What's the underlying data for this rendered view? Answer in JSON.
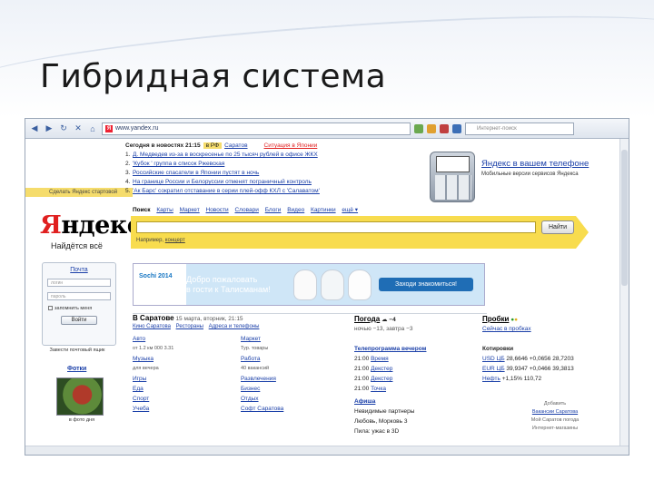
{
  "slide": {
    "title": "Гибридная система"
  },
  "browser": {
    "address": "www.yandex.ru",
    "search_placeholder": "Интернет-поиск",
    "nav_back": "◀",
    "nav_forward": "▶",
    "nav_refresh": "↻",
    "nav_stop": "✕",
    "nav_home": "⌂"
  },
  "news": {
    "header": "Сегодня в новостях 21:15",
    "tab_rf": "в РФ",
    "tab_saratov": "Саратов",
    "hot": "Ситуация в Японии",
    "items": [
      {
        "num": "1.",
        "text": "Д. Медведев из-за в воскресенье по 25 тысяч рублей в офисе ЖКХ"
      },
      {
        "num": "2.",
        "text": "'Кубок ' группа в список Ржевская"
      },
      {
        "num": "3.",
        "text": "Российские спасатели в Японии пустят в ночь"
      },
      {
        "num": "4.",
        "text": "На границе России и Белоруссии отменят пограничный контроль"
      },
      {
        "num": "5.",
        "text": "'Ак Барс' сократил отставание в серии плей-офф КХЛ с 'Салаватом'"
      }
    ]
  },
  "mobile": {
    "title": "Яндекс в вашем телефоне",
    "desc": "Мобильные версии сервисов Яндекса"
  },
  "left": {
    "logo_first": "Я",
    "logo_rest": "ндекс",
    "slogan": "Найдётся всё",
    "make_start": "Сделать Яндекс стартовой",
    "login_title": "Почта",
    "login_field": "логин",
    "password_field": "пароль",
    "remember": "запомнить меня",
    "login_button": "Войти",
    "make_home": "Завести почтовый ящик",
    "photos_title": "Фотки",
    "photo_caption": "в фото дня"
  },
  "services": {
    "items": [
      "Поиск",
      "Карты",
      "Маркет",
      "Новости",
      "Словари",
      "Блоги",
      "Видео",
      "Картинки",
      "ещё ▾"
    ]
  },
  "search": {
    "button": "Найти",
    "example_prefix": "Например,",
    "example": "концерт"
  },
  "banner": {
    "logo": "Sochi 2014",
    "text_line1": "Добро пожаловать",
    "text_line2": "в гости к Талисманам!",
    "button": "Заходи знакомиться!"
  },
  "city": {
    "title": "В Саратове",
    "date": "15 марта, вторник, 21:15",
    "subs": [
      "Кино Саратова",
      "Рестораны",
      "Адреса и телефоны"
    ],
    "left_items": [
      {
        "label": "Авто",
        "sub": "от 1.2 км 000 3.31"
      },
      {
        "label": "Музыка",
        "sub": "для вечера"
      },
      {
        "label": "Игры",
        "sub": ""
      },
      {
        "label": "Еда",
        "sub": ""
      },
      {
        "label": "Спорт",
        "sub": ""
      },
      {
        "label": "Учеба",
        "sub": ""
      }
    ],
    "right_items": [
      {
        "label": "Маркет",
        "sub": "Тур. товары"
      },
      {
        "label": "Работа",
        "sub": "40 вакансий"
      },
      {
        "label": "Развлечения",
        "sub": ""
      },
      {
        "label": "Бизнес",
        "sub": ""
      },
      {
        "label": "Отдых",
        "sub": ""
      },
      {
        "label": "Софт Саратова",
        "sub": ""
      }
    ]
  },
  "weather": {
    "title": "Погода",
    "temp": "−4",
    "detail": "ночью −13, завтра −3"
  },
  "tv": {
    "title": "Телепрограмма вечером",
    "rows": [
      {
        "time": "21:00",
        "show": "Время"
      },
      {
        "time": "21:00",
        "show": "Декстер"
      },
      {
        "time": "21:00",
        "show": "Декстер"
      },
      {
        "time": "21:00",
        "show": "Точка"
      }
    ]
  },
  "afisha": {
    "title": "Афиша",
    "rows": [
      "Невидимые партнеры",
      "Любовь, Морковь 3",
      "Пила: ужас в 3D"
    ]
  },
  "traffic": {
    "title": "Пробки",
    "detail": "Сейчас в пробках"
  },
  "quotes": {
    "title": "Котировки",
    "rows": [
      {
        "name": "USD ЦБ",
        "v1": "28,6646",
        "v2": "+0,0656",
        "v3": "28,7203"
      },
      {
        "name": "EUR ЦБ",
        "v1": "39,9347",
        "v2": "+0,0466",
        "v3": "39,3813"
      },
      {
        "name": "Нефть",
        "v1": "+1,15%",
        "v2": "110,72",
        "v3": ""
      }
    ]
  },
  "right_links": [
    "Добавить",
    "Вакансии Саратова",
    "Мой Саратов погода",
    "Интернет-магазины"
  ]
}
